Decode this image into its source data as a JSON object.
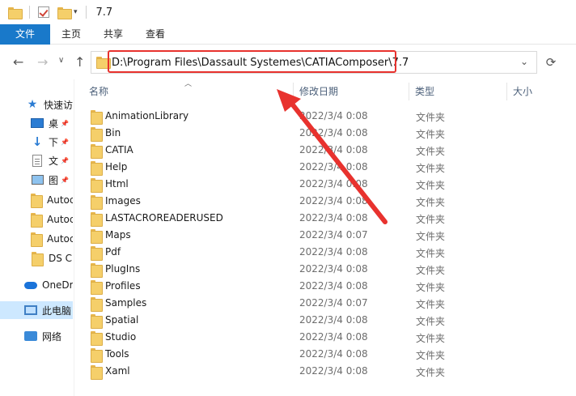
{
  "titlebar": {
    "title": "7.7",
    "quick_access_arrow": "▾"
  },
  "ribbon": {
    "tabs": [
      "文件",
      "主页",
      "共享",
      "查看"
    ]
  },
  "nav": {
    "back": "←",
    "forward": "→",
    "recent": "∨",
    "up": "↑",
    "refresh": "⟳"
  },
  "address": {
    "path": "D:\\Program Files\\Dassault Systemes\\CATIAComposer\\7.7",
    "dropdown": "⌄"
  },
  "highlight": {
    "color": "#e8322e"
  },
  "sidebar": {
    "items": [
      {
        "label": "快速访",
        "icon": "star-icon",
        "pinned": false
      },
      {
        "label": "桌",
        "icon": "desktop-icon",
        "pinned": true
      },
      {
        "label": "下",
        "icon": "download-icon",
        "pinned": true
      },
      {
        "label": "文",
        "icon": "document-icon",
        "pinned": true
      },
      {
        "label": "图",
        "icon": "picture-icon",
        "pinned": true
      },
      {
        "label": "Autoc",
        "icon": "folder-icon",
        "pinned": false
      },
      {
        "label": "Autoc",
        "icon": "folder-icon",
        "pinned": false
      },
      {
        "label": "Autoc",
        "icon": "folder-icon",
        "pinned": false
      },
      {
        "label": "DS C",
        "icon": "folder-icon",
        "pinned": false
      },
      {
        "label": "OneDr",
        "icon": "cloud-icon",
        "pinned": false
      },
      {
        "label": "此电脑",
        "icon": "computer-icon",
        "pinned": false,
        "selected": true
      },
      {
        "label": "网络",
        "icon": "network-icon",
        "pinned": false
      }
    ]
  },
  "columns": {
    "name": "名称",
    "modified": "修改日期",
    "type": "类型",
    "size": "大小"
  },
  "files": [
    {
      "name": "AnimationLibrary",
      "date": "2022/3/4 0:08",
      "type": "文件夹"
    },
    {
      "name": "Bin",
      "date": "2022/3/4 0:08",
      "type": "文件夹"
    },
    {
      "name": "CATIA",
      "date": "2022/3/4 0:08",
      "type": "文件夹"
    },
    {
      "name": "Help",
      "date": "2022/3/4 0:08",
      "type": "文件夹"
    },
    {
      "name": "Html",
      "date": "2022/3/4 0:08",
      "type": "文件夹"
    },
    {
      "name": "Images",
      "date": "2022/3/4 0:08",
      "type": "文件夹"
    },
    {
      "name": "LASTACROREADERUSED",
      "date": "2022/3/4 0:08",
      "type": "文件夹"
    },
    {
      "name": "Maps",
      "date": "2022/3/4 0:07",
      "type": "文件夹"
    },
    {
      "name": "Pdf",
      "date": "2022/3/4 0:08",
      "type": "文件夹"
    },
    {
      "name": "PlugIns",
      "date": "2022/3/4 0:08",
      "type": "文件夹"
    },
    {
      "name": "Profiles",
      "date": "2022/3/4 0:08",
      "type": "文件夹"
    },
    {
      "name": "Samples",
      "date": "2022/3/4 0:07",
      "type": "文件夹"
    },
    {
      "name": "Spatial",
      "date": "2022/3/4 0:08",
      "type": "文件夹"
    },
    {
      "name": "Studio",
      "date": "2022/3/4 0:08",
      "type": "文件夹"
    },
    {
      "name": "Tools",
      "date": "2022/3/4 0:08",
      "type": "文件夹"
    },
    {
      "name": "Xaml",
      "date": "2022/3/4 0:08",
      "type": "文件夹"
    }
  ]
}
